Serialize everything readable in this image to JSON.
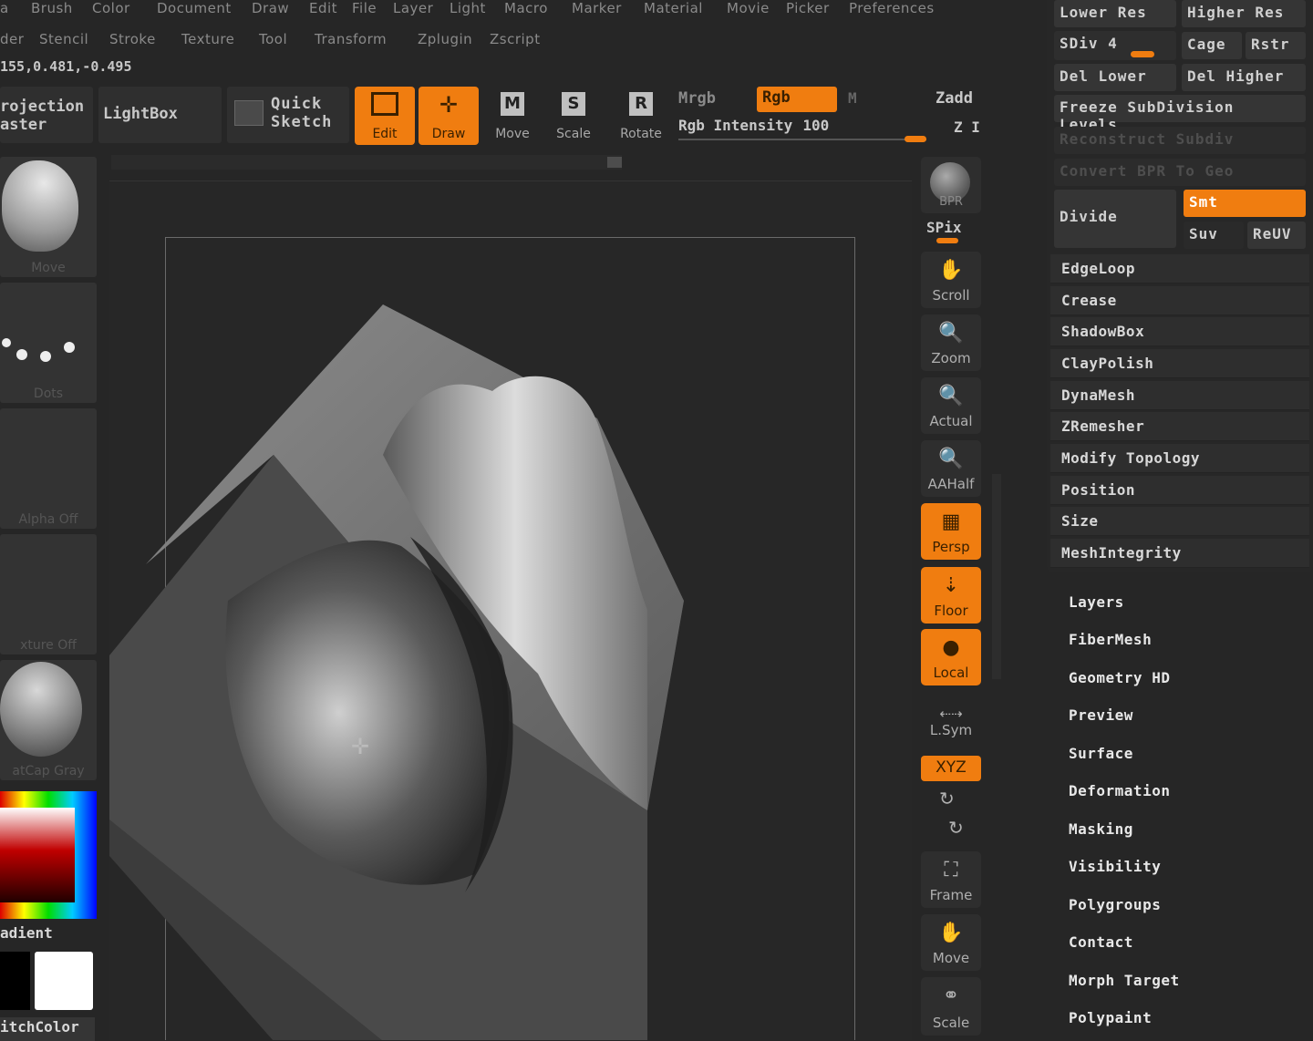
{
  "menu_row1": [
    "a",
    "Brush",
    "Color",
    "Document",
    "Draw",
    "Edit",
    "File",
    "Layer",
    "Light",
    "Macro",
    "Marker",
    "Material",
    "Movie",
    "Picker",
    "Preferences"
  ],
  "menu_row2": [
    "der",
    "Stencil",
    "Stroke",
    "Texture",
    "Tool",
    "Transform",
    "Zplugin",
    "Zscript"
  ],
  "coords": "155,0.481,-0.495",
  "projection": {
    "line1": "rojection",
    "line2": "aster"
  },
  "lightbox": "LightBox",
  "quick_sketch": {
    "line1": "Quick",
    "line2": "Sketch"
  },
  "tools": {
    "edit": "Edit",
    "draw": "Draw",
    "move": "Move",
    "scale": "Scale",
    "rotate": "Rotate"
  },
  "color_modes": {
    "mrgb": "Mrgb",
    "rgb": "Rgb",
    "m": "M",
    "zadd": "Zadd",
    "zsub": "Z I"
  },
  "rgb_intensity": {
    "label": "Rgb Intensity",
    "value": "100"
  },
  "left_panel": {
    "brush": "Move",
    "stroke": "Dots",
    "alpha": "Alpha Off",
    "texture": "xture Off",
    "material": "atCap Gray",
    "gradient": "adient",
    "switch_color": "itchColor"
  },
  "right_shelf": {
    "bpr": "BPR",
    "spix": "SPix",
    "scroll": "Scroll",
    "zoom": "Zoom",
    "actual": "Actual",
    "aahalf": "AAHalf",
    "persp": "Persp",
    "floor": "Floor",
    "local": "Local",
    "lsym": "L.Sym",
    "xyz": "XYZ",
    "frame": "Frame",
    "move": "Move",
    "scale": "Scale"
  },
  "geometry": {
    "lower_res": "Lower Res",
    "higher_res": "Higher Res",
    "sdiv": "SDiv 4",
    "cage": "Cage",
    "rstr": "Rstr",
    "del_lower": "Del Lower",
    "del_higher": "Del Higher",
    "freeze": "Freeze SubDivision Levels",
    "reconstruct": "Reconstruct Subdiv",
    "convert_bpr": "Convert BPR To Geo",
    "divide": "Divide",
    "smt": "Smt",
    "suv": "Suv",
    "reuv": "ReUV",
    "items": [
      "EdgeLoop",
      "Crease",
      "ShadowBox",
      "ClayPolish",
      "DynaMesh",
      "ZRemesher",
      "Modify Topology",
      "Position",
      "Size",
      "MeshIntegrity"
    ]
  },
  "subpalettes": [
    "Layers",
    "FiberMesh",
    "Geometry HD",
    "Preview",
    "Surface",
    "Deformation",
    "Masking",
    "Visibility",
    "Polygroups",
    "Contact",
    "Morph Target",
    "Polypaint"
  ],
  "colors": {
    "accent": "#f07d10",
    "background": "#262626",
    "panel": "#2e2e2e"
  }
}
